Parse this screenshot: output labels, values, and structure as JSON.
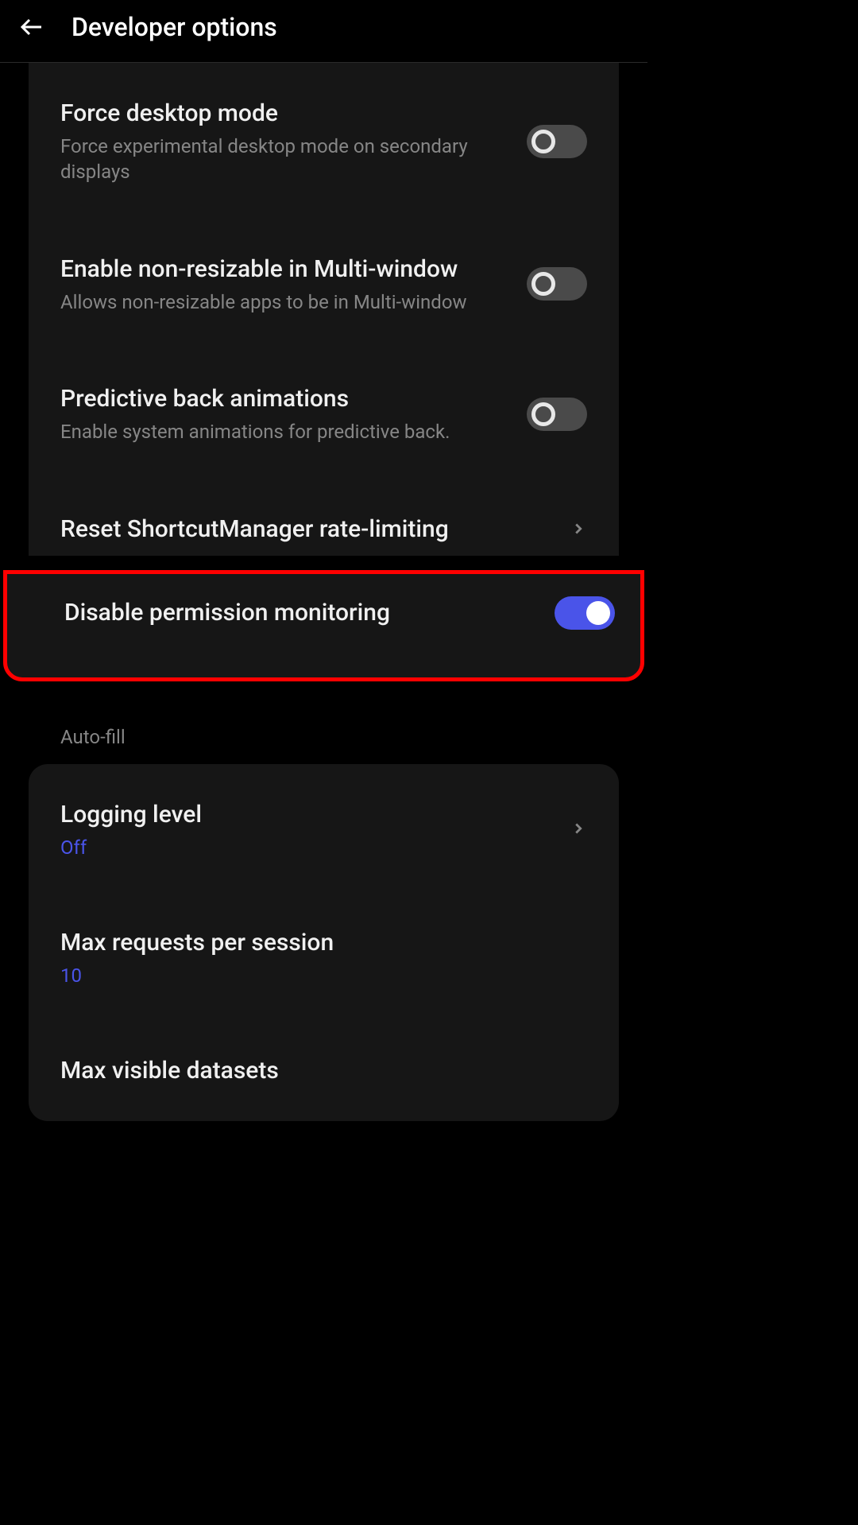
{
  "header": {
    "title": "Developer options"
  },
  "group1": {
    "items": [
      {
        "title": "Force desktop mode",
        "subtitle": "Force experimental desktop mode on secondary displays",
        "toggle": "off"
      },
      {
        "title": "Enable non-resizable in Multi-window",
        "subtitle": "Allows non-resizable apps to be in Multi-window",
        "toggle": "off"
      },
      {
        "title": "Predictive back animations",
        "subtitle": "Enable system animations for predictive back.",
        "toggle": "off"
      },
      {
        "title": "Reset ShortcutManager rate-limiting",
        "type": "chevron"
      }
    ]
  },
  "highlight": {
    "title": "Disable permission monitoring",
    "toggle": "on"
  },
  "section_label": "Auto-fill",
  "group2": {
    "items": [
      {
        "title": "Logging level",
        "value": "Off",
        "type": "chevron"
      },
      {
        "title": "Max requests per session",
        "value": "10"
      },
      {
        "title": "Max visible datasets"
      }
    ]
  }
}
